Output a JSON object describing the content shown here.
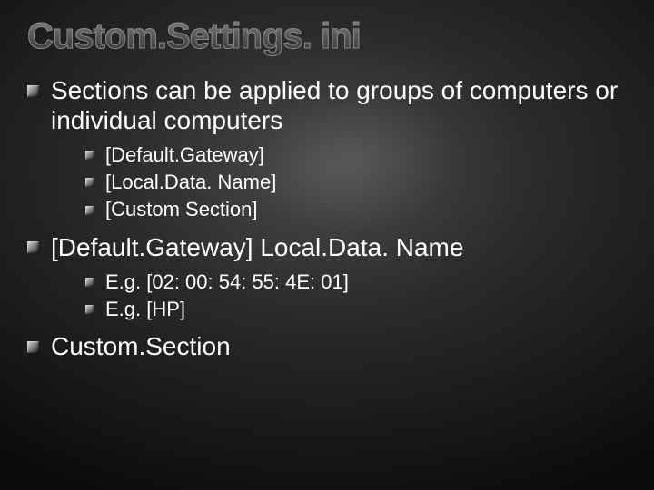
{
  "title": "Custom.Settings. ini",
  "bullets": [
    {
      "text": "Sections can be applied to groups of computers or individual computers",
      "children": [
        {
          "text": "[Default.Gateway]"
        },
        {
          "text": "[Local.Data. Name]"
        },
        {
          "text": "[Custom Section]"
        }
      ]
    },
    {
      "text": "[Default.Gateway] Local.Data. Name",
      "children": [
        {
          "text": "E.g. [02: 00: 54: 55: 4E: 01]"
        },
        {
          "text": "E.g. [HP]"
        }
      ]
    },
    {
      "text": "Custom.Section"
    }
  ]
}
